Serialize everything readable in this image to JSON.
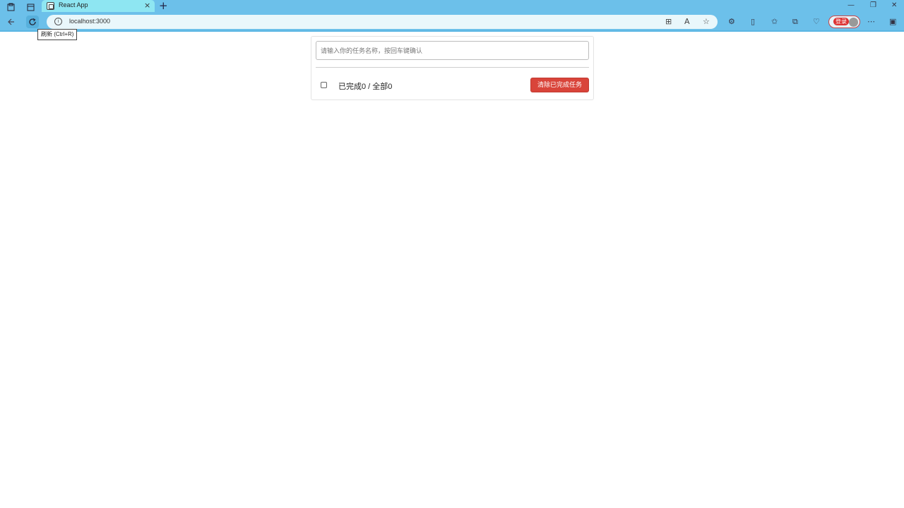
{
  "browser": {
    "tab_title": "React App",
    "tab_close": "×",
    "new_tab": "+",
    "window_controls": {
      "minimize": "—",
      "restore": "❐",
      "close": "✕"
    },
    "address": "localhost:3000",
    "tooltip": "刷新 (Ctrl+R)",
    "profile_badge": "登录",
    "icons": {
      "workspaces": "workspaces-icon",
      "tab_actions": "tab-actions-icon",
      "back": "back-arrow-icon",
      "reload": "reload-icon",
      "site_info": "info-icon",
      "apps": "app-available-icon",
      "read_aloud": "read-aloud-icon",
      "favorite": "star-icon",
      "extensions": "extensions-icon",
      "split_screen": "split-screen-icon",
      "favorites": "favorites-icon",
      "collections": "collections-icon",
      "browser_essentials": "browser-essentials-icon",
      "more": "more-icon",
      "sidebar": "sidebar-icon"
    }
  },
  "app": {
    "input_placeholder": "请输入你的任务名称，按回车键确认",
    "footer_status": "已完成0 / 全部0",
    "clear_button": "清除已完成任务",
    "accent_color": "#d9443a"
  }
}
